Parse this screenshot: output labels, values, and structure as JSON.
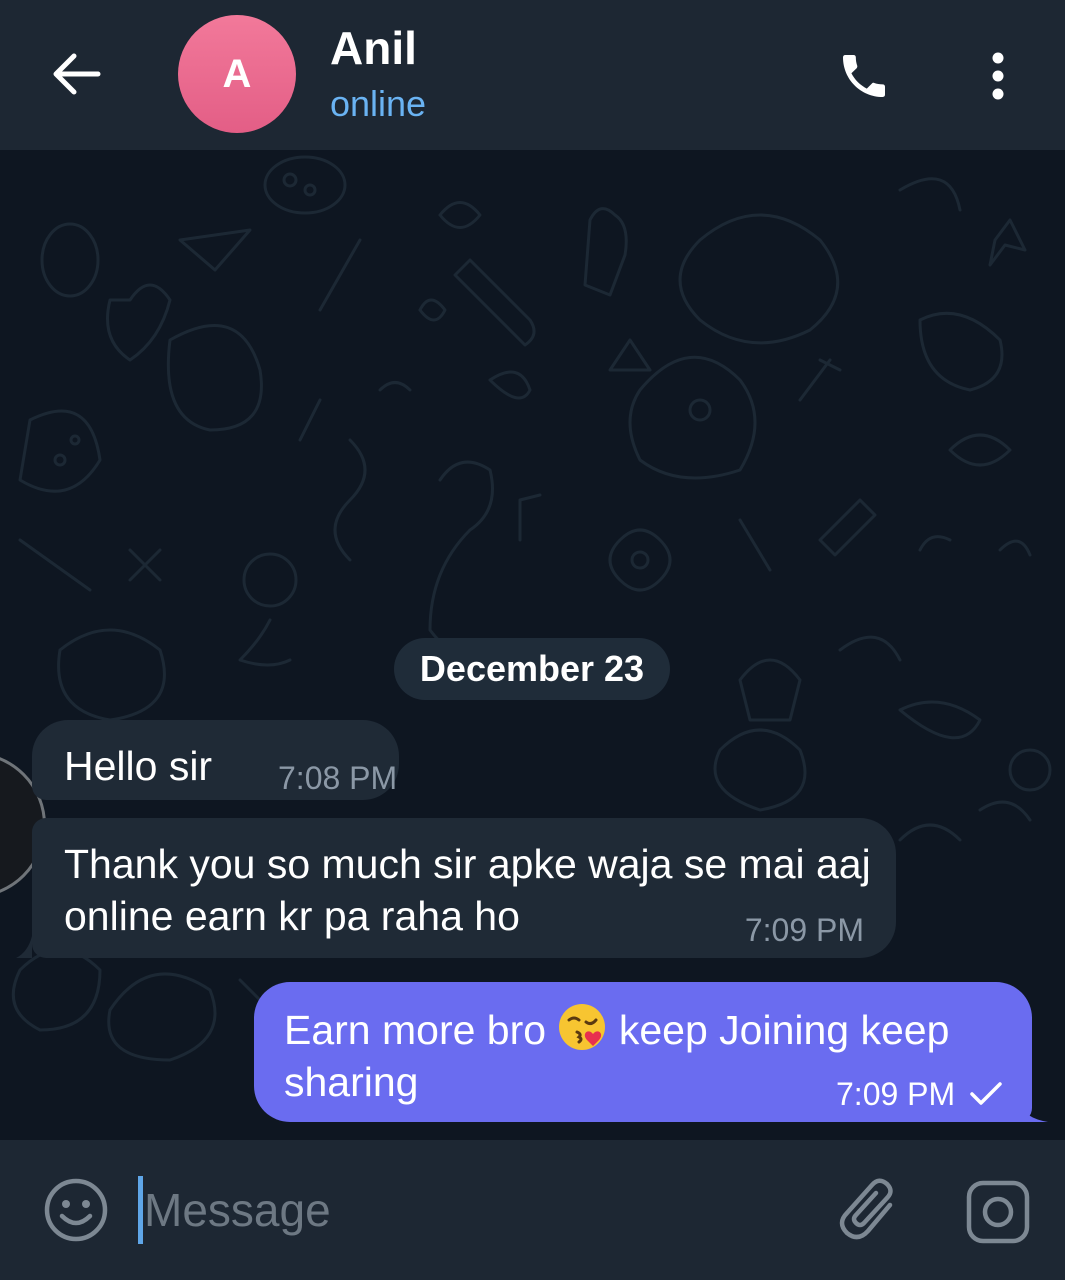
{
  "header": {
    "avatar_initial": "A",
    "contact_name": "Anil",
    "status": "online"
  },
  "chat": {
    "date_separator": "December 23",
    "messages": [
      {
        "direction": "incoming",
        "text": "Hello sir",
        "time": "7:08 PM"
      },
      {
        "direction": "incoming",
        "text": "Thank you so much sir apke waja se mai aaj online earn kr pa raha ho",
        "time": "7:09 PM"
      },
      {
        "direction": "outgoing",
        "text_before_emoji": "Earn more bro",
        "emoji": "face-blowing-a-kiss",
        "text_after_emoji": "keep Joining keep sharing",
        "time": "7:09 PM",
        "status": "sent"
      }
    ]
  },
  "composer": {
    "placeholder": "Message"
  },
  "colors": {
    "header_bg": "#1d2733",
    "chat_bg": "#0e1621",
    "incoming_bubble": "#1f2a36",
    "outgoing_bubble": "#6a6cf0",
    "status_blue": "#6ab3f3",
    "avatar_pink": "#e96a8f"
  },
  "icons": {
    "back": "arrow-left-icon",
    "call": "phone-icon",
    "menu": "more-vertical-icon",
    "emoji": "smile-icon",
    "attach": "paperclip-icon",
    "camera": "camera-icon",
    "sent": "check-icon"
  }
}
